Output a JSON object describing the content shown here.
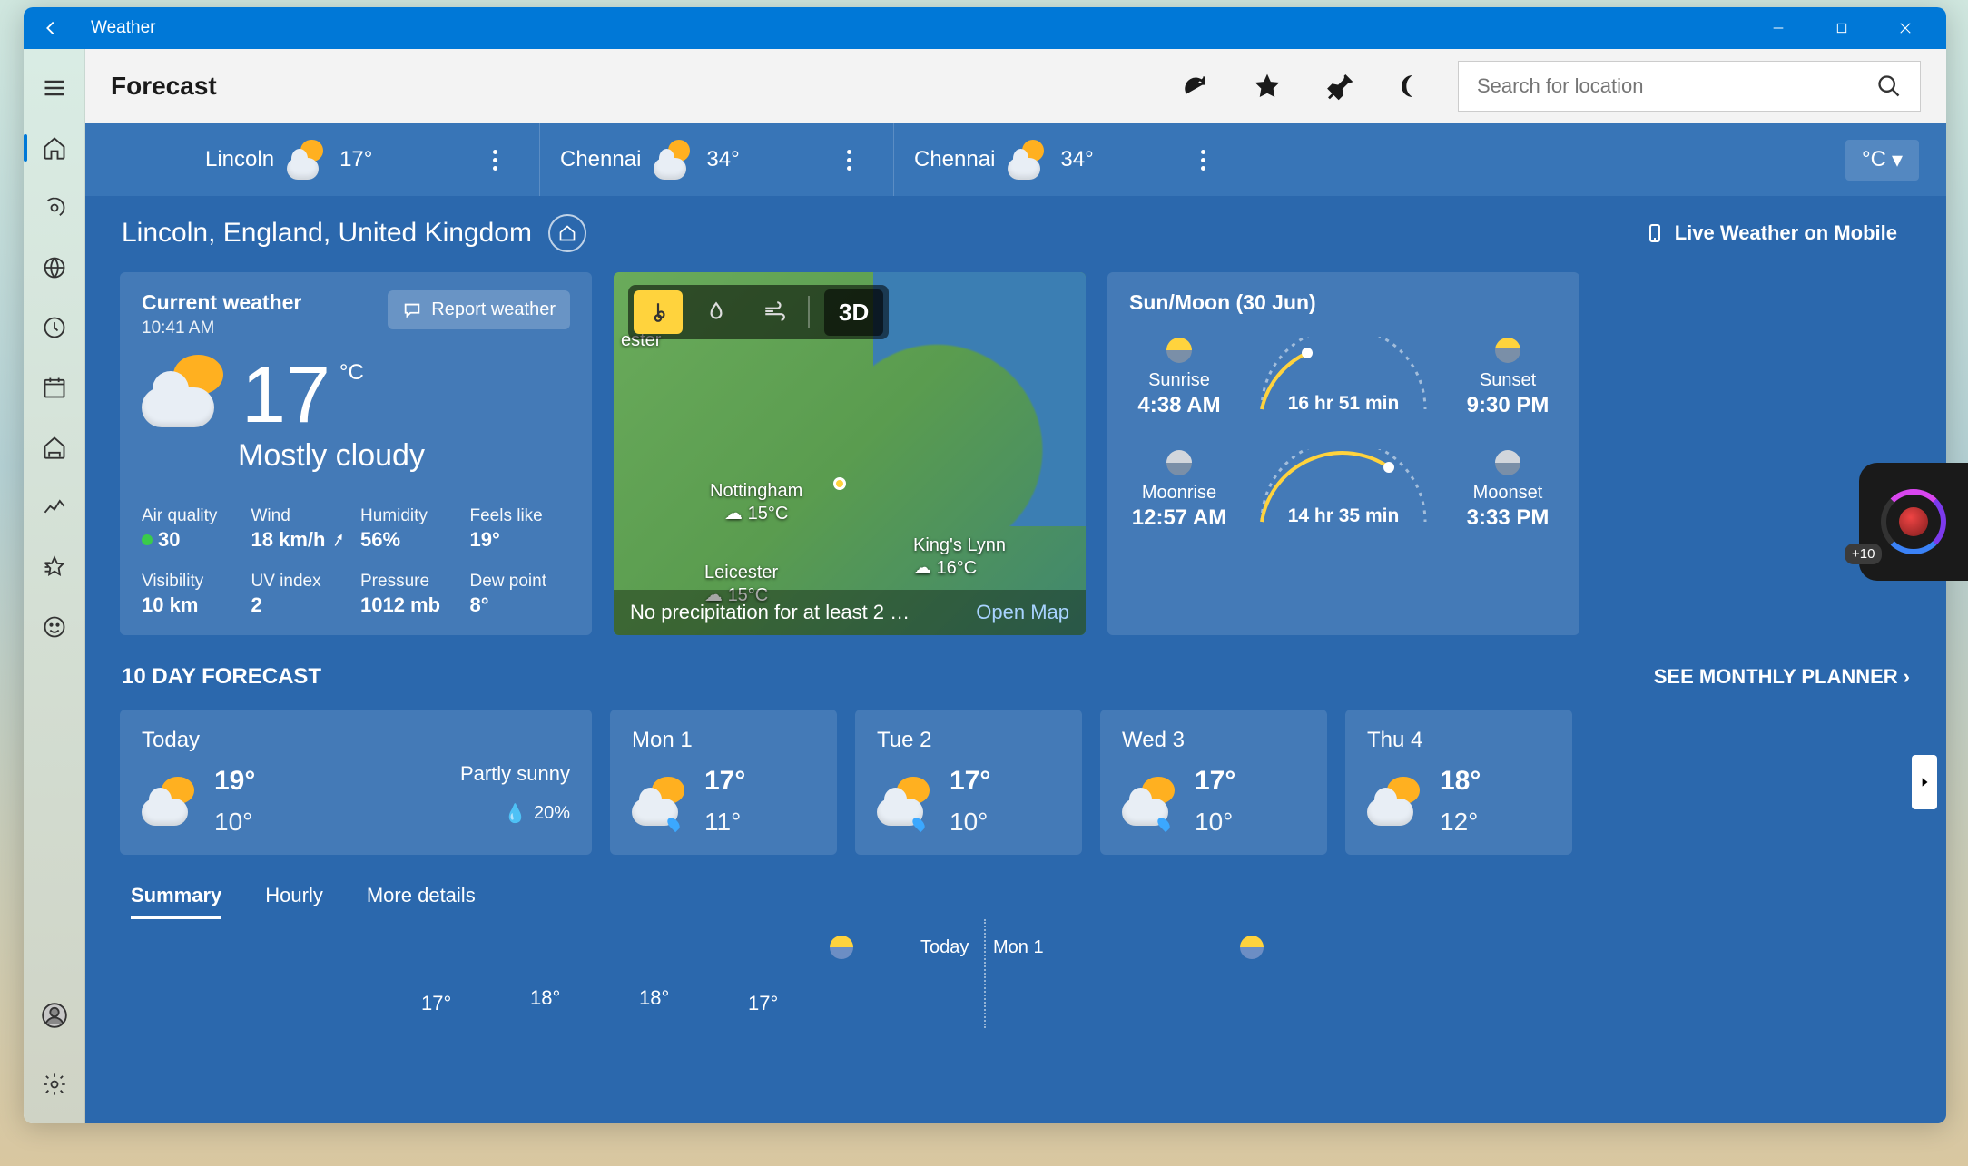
{
  "app": {
    "title": "Weather",
    "page": "Forecast"
  },
  "window_controls": {
    "minimize": "—",
    "maximize": "▢",
    "close": "✕"
  },
  "search": {
    "placeholder": "Search for location"
  },
  "favorites": [
    {
      "name": "Lincoln",
      "temp": "17°"
    },
    {
      "name": "Chennai",
      "temp": "34°"
    },
    {
      "name": "Chennai",
      "temp": "34°"
    }
  ],
  "units": {
    "label": "°C",
    "caret": "▾"
  },
  "location": {
    "full": "Lincoln, England, United Kingdom"
  },
  "mobile_link": "Live Weather on Mobile",
  "current": {
    "title": "Current weather",
    "time": "10:41 AM",
    "report_label": "Report weather",
    "temp": "17",
    "temp_unit": "°C",
    "condition": "Mostly cloudy",
    "stats": {
      "air_quality": {
        "label": "Air quality",
        "value": "30"
      },
      "wind": {
        "label": "Wind",
        "value": "18 km/h"
      },
      "humidity": {
        "label": "Humidity",
        "value": "56%"
      },
      "feels": {
        "label": "Feels like",
        "value": "19°"
      },
      "visibility": {
        "label": "Visibility",
        "value": "10 km"
      },
      "uv": {
        "label": "UV index",
        "value": "2"
      },
      "pressure": {
        "label": "Pressure",
        "value": "1012 mb"
      },
      "dew": {
        "label": "Dew point",
        "value": "8°"
      }
    }
  },
  "map": {
    "mode_3d": "3D",
    "footer_text": "No precipitation for at least 2 …",
    "open_label": "Open Map",
    "cities": [
      {
        "name": "ester",
        "temp": ""
      },
      {
        "name": "Nottingham",
        "temp": "15°C"
      },
      {
        "name": "Leicester",
        "temp": "15°C"
      },
      {
        "name": "King's Lynn",
        "temp": "16°C"
      }
    ]
  },
  "sunmoon": {
    "title": "Sun/Moon (30 Jun)",
    "sunrise": {
      "label": "Sunrise",
      "value": "4:38 AM"
    },
    "sunset": {
      "label": "Sunset",
      "value": "9:30 PM"
    },
    "daylight": "16 hr 51 min",
    "moonrise": {
      "label": "Moonrise",
      "value": "12:57 AM"
    },
    "moonset": {
      "label": "Moonset",
      "value": "3:33 PM"
    },
    "moonlight": "14 hr 35 min"
  },
  "forecast": {
    "header": "10 DAY FORECAST",
    "planner_link": "SEE MONTHLY PLANNER",
    "today": {
      "day": "Today",
      "hi": "19°",
      "lo": "10°",
      "desc": "Partly sunny",
      "precip": "20%"
    },
    "days": [
      {
        "day": "Mon 1",
        "hi": "17°",
        "lo": "11°",
        "rain": true
      },
      {
        "day": "Tue 2",
        "hi": "17°",
        "lo": "10°",
        "rain": true
      },
      {
        "day": "Wed 3",
        "hi": "17°",
        "lo": "10°",
        "rain": true
      },
      {
        "day": "Thu 4",
        "hi": "18°",
        "lo": "12°",
        "rain": false
      }
    ]
  },
  "detail_tabs": {
    "summary": "Summary",
    "hourly": "Hourly",
    "more": "More details"
  },
  "chart": {
    "today_label": "Today",
    "tomorrow_label": "Mon 1",
    "temps": [
      "17°",
      "18°",
      "18°",
      "17°"
    ]
  },
  "widget": {
    "badge": "+10"
  }
}
